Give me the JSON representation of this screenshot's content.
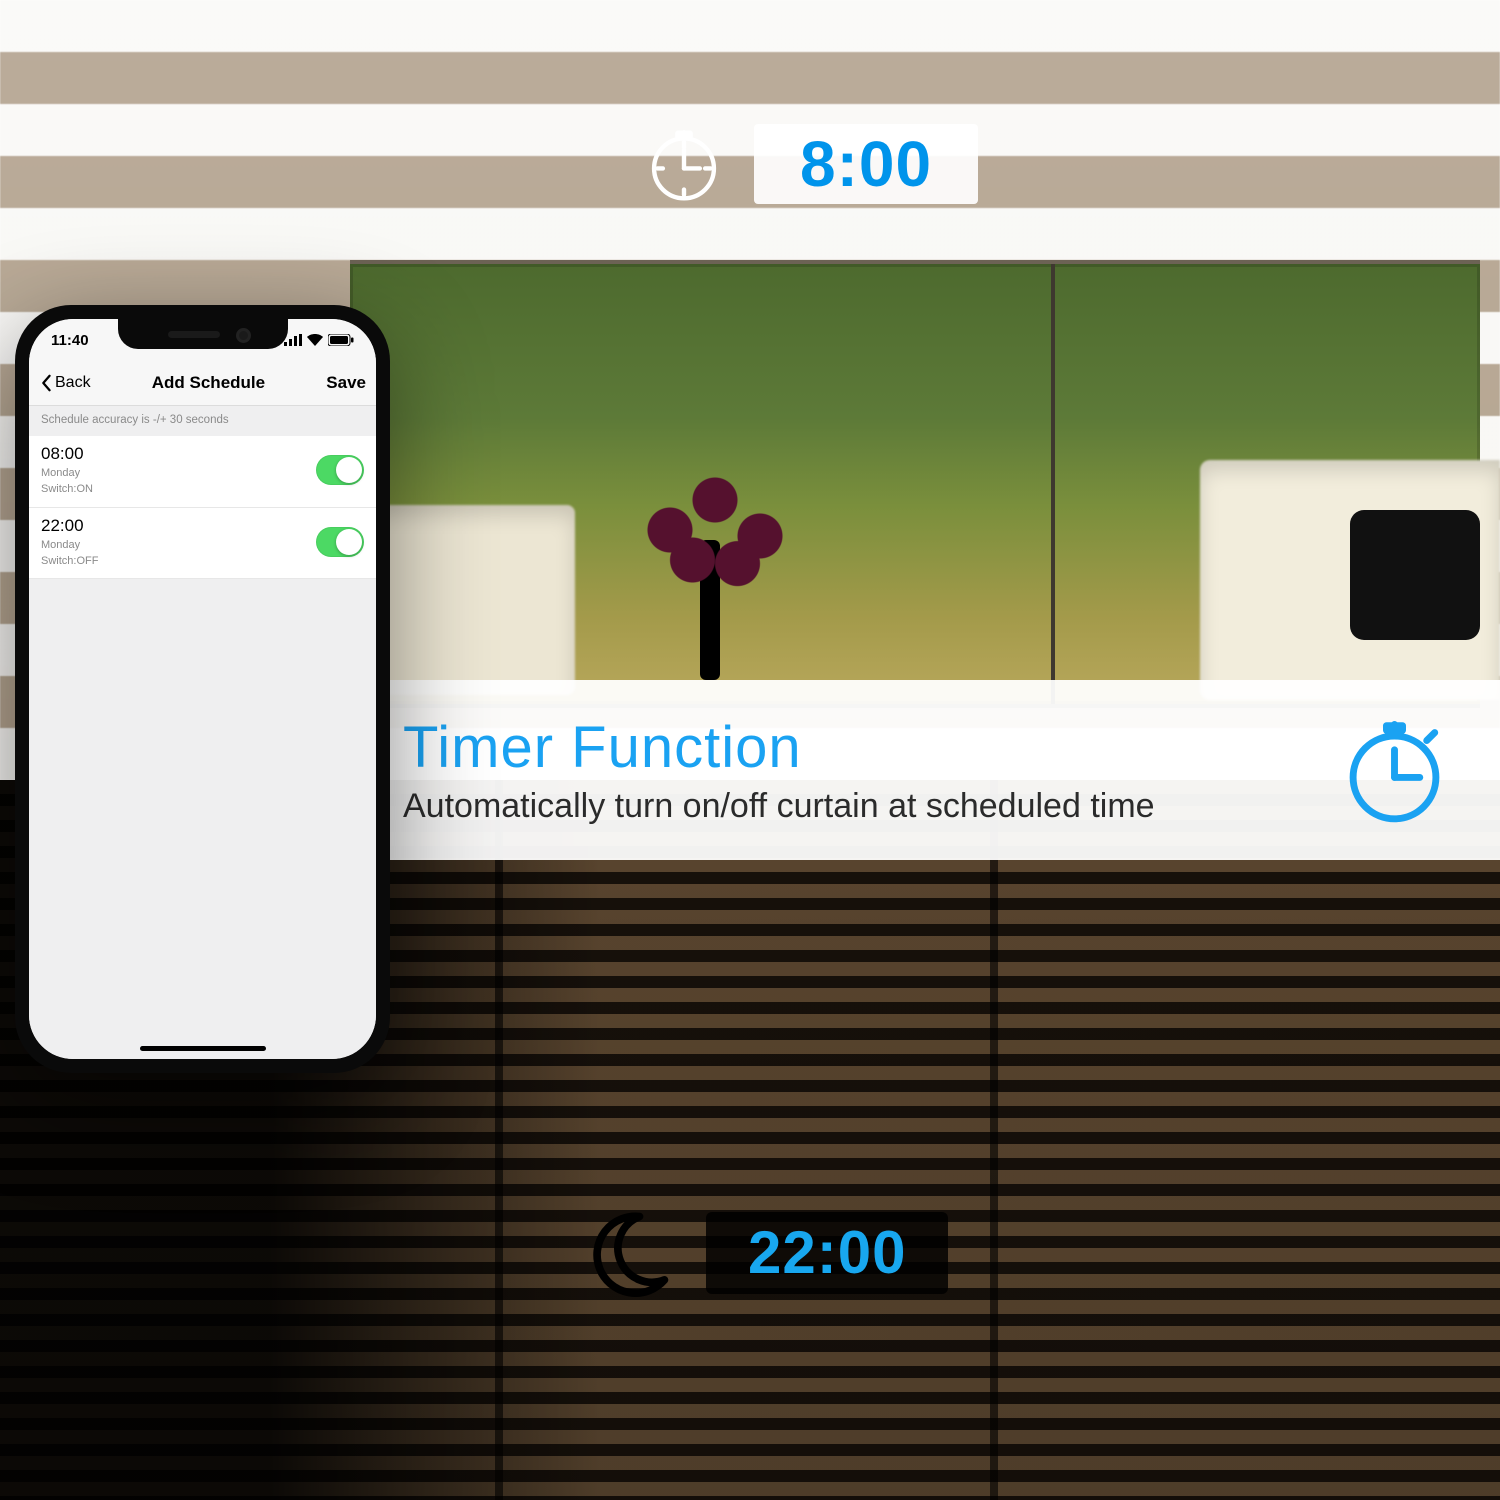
{
  "badges": {
    "morning_time": "8:00",
    "night_time": "22:00"
  },
  "strip": {
    "title": "Timer Function",
    "subtitle": "Automatically turn on/off curtain at scheduled time"
  },
  "phone": {
    "status": {
      "time": "11:40"
    },
    "nav": {
      "back": "Back",
      "title": "Add Schedule",
      "save": "Save"
    },
    "note": "Schedule accuracy is -/+ 30 seconds",
    "schedules": [
      {
        "time": "08:00",
        "day": "Monday",
        "switch": "Switch:ON",
        "on": true
      },
      {
        "time": "22:00",
        "day": "Monday",
        "switch": "Switch:OFF",
        "on": true
      }
    ]
  }
}
